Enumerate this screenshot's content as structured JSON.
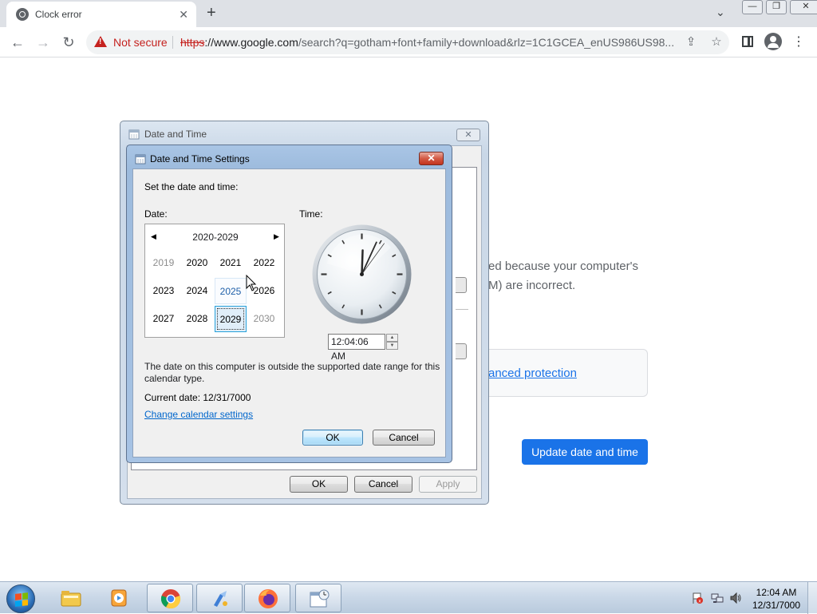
{
  "browser": {
    "tab_title": "Clock error",
    "tab_close": "✕",
    "new_tab": "+",
    "security_text": "Not secure",
    "url_scheme": "https",
    "url_host": "://www.google.com",
    "url_rest": "/search?q=gotham+font+family+download&rlz=1C1GCEA_enUS986US98..."
  },
  "page": {
    "body_line1": "ed because your computer's",
    "body_line2": "M) are incorrect.",
    "advanced_link": "anced protection",
    "update_button": "Update date and time"
  },
  "outer_dialog": {
    "title": "Date and Time",
    "close": "✕",
    "ok": "OK",
    "cancel": "Cancel",
    "apply": "Apply"
  },
  "inner_dialog": {
    "title": "Date and Time Settings",
    "close": "✕",
    "instruction": "Set the date and time:",
    "date_label": "Date:",
    "time_label": "Time:",
    "decade_header": "2020-2029",
    "prev_arrow": "◀",
    "next_arrow": "▶",
    "years": [
      {
        "label": "2019",
        "state": "dim"
      },
      {
        "label": "2020",
        "state": "normal"
      },
      {
        "label": "2021",
        "state": "normal"
      },
      {
        "label": "2022",
        "state": "normal"
      },
      {
        "label": "2023",
        "state": "normal"
      },
      {
        "label": "2024",
        "state": "normal"
      },
      {
        "label": "2025",
        "state": "hover"
      },
      {
        "label": "2026",
        "state": "normal"
      },
      {
        "label": "2027",
        "state": "normal"
      },
      {
        "label": "2028",
        "state": "normal"
      },
      {
        "label": "2029",
        "state": "selected"
      },
      {
        "label": "2030",
        "state": "dim"
      }
    ],
    "time_value": "12:04:06 AM",
    "clock_hour": 0,
    "clock_minute": 4,
    "clock_second": 6,
    "message": "The date on this computer is outside the supported date range for this calendar type.",
    "current_date": "Current date: 12/31/7000",
    "change_link": "Change calendar settings",
    "ok": "OK",
    "cancel": "Cancel"
  },
  "taskbar": {
    "time": "12:04 AM",
    "date": "12/31/7000"
  },
  "colors": {
    "accent_blue": "#1a73e8",
    "not_secure_red": "#c5221f",
    "link_blue": "#0066cc"
  }
}
